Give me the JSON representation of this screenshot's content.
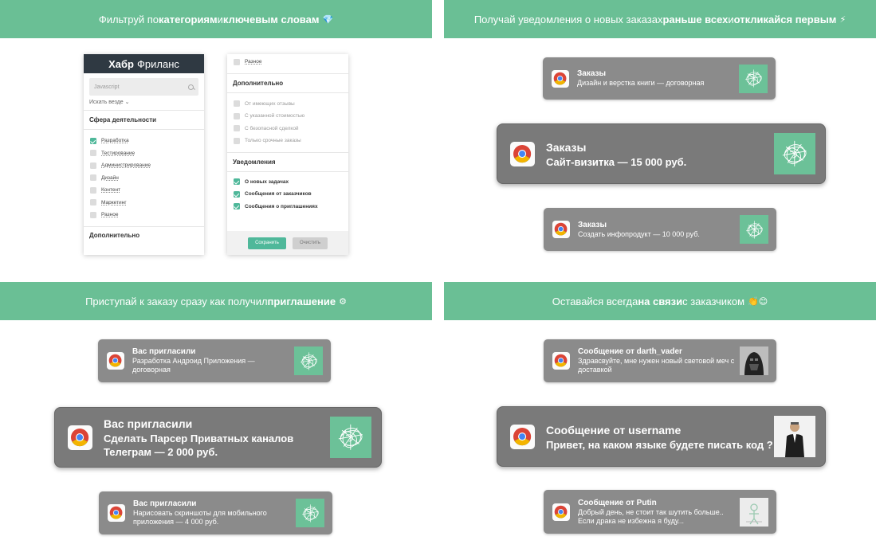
{
  "panels": {
    "tl": {
      "banner": {
        "p1": "Фильтруй по ",
        "b1": "категориям",
        "p2": " и ",
        "b2": "ключевым словам",
        "emoji": "💎"
      },
      "left_card": {
        "brand_bold": "Хабр",
        "brand_rest": "Фриланс",
        "search_placeholder": "Javascript",
        "search_scope": "Искать везде ⌄",
        "section_title": "Сфера деятельности",
        "categories": [
          {
            "label": "Разработка",
            "checked": true
          },
          {
            "label": "Тестирование",
            "checked": false
          },
          {
            "label": "Администрирование",
            "checked": false
          },
          {
            "label": "Дизайн",
            "checked": false
          },
          {
            "label": "Контент",
            "checked": false
          },
          {
            "label": "Маркетинг",
            "checked": false
          },
          {
            "label": "Разное",
            "checked": false
          }
        ],
        "footer_title": "Дополнительно"
      },
      "right_card": {
        "top_item": "Разное",
        "extra_title": "Дополнительно",
        "extra_items": [
          "От имеющих отзывы",
          "С указанной стоимостью",
          "С безопасной сделкой",
          "Только срочные заказы"
        ],
        "notif_title": "Уведомления",
        "notif_items": [
          "О новых задачах",
          "Сообщения от заказчиков",
          "Сообщения о приглашениях"
        ],
        "save_label": "Сохранить",
        "clear_label": "Очистить"
      }
    },
    "tr": {
      "banner": {
        "p1": "Получай уведомления о новых заказах ",
        "b1": "раньше всех",
        "p2": " и ",
        "b2": "откликайся первым",
        "emoji": "⚡"
      },
      "notifications": [
        {
          "title": "Заказы",
          "body": "Дизайн и верстка книги — договорная"
        },
        {
          "title": "Заказы",
          "body": "Сайт-визитка — 15 000 руб."
        },
        {
          "title": "Заказы",
          "body": "Создать инфопродукт — 10 000 руб."
        }
      ]
    },
    "bl": {
      "banner": {
        "p1": "Приступай к заказу сразу как получил ",
        "b1": "приглашение",
        "emoji": "⚙"
      },
      "notifications": [
        {
          "title": "Вас пригласили",
          "body": "Разработка Андроид Приложения — договорная"
        },
        {
          "title": "Вас пригласили",
          "body": "Сделать Парсер Приватных каналов Телеграм — 2 000 руб."
        },
        {
          "title": "Вас пригласили",
          "body": "Нарисовать скриншоты для мобильного приложения — 4 000 руб."
        }
      ]
    },
    "br": {
      "banner": {
        "p1": "Оставайся всегда ",
        "b1": "на связи",
        "p2": " с заказчиком ",
        "emoji": "👏😊"
      },
      "notifications": [
        {
          "title": "Сообщение от darth_vader",
          "body": "Здравсвуйте, мне нужен новый световой меч с доставкой"
        },
        {
          "title": "Сообщение от username",
          "body": "Привет, на каком языке будете писать код ?"
        },
        {
          "title": "Сообщение от Putin",
          "body": "Добрый день, не стоит так шутить больше.. Если драка не избежна я буду..."
        }
      ]
    }
  },
  "colors": {
    "banner": "#6abf95",
    "notification": "#8b8b8b",
    "accent": "#4fb89a",
    "thumb": "#6cc198"
  },
  "icons": {
    "notification_app": "chrome-icon",
    "thumbnail": "habr-scribble-logo"
  }
}
